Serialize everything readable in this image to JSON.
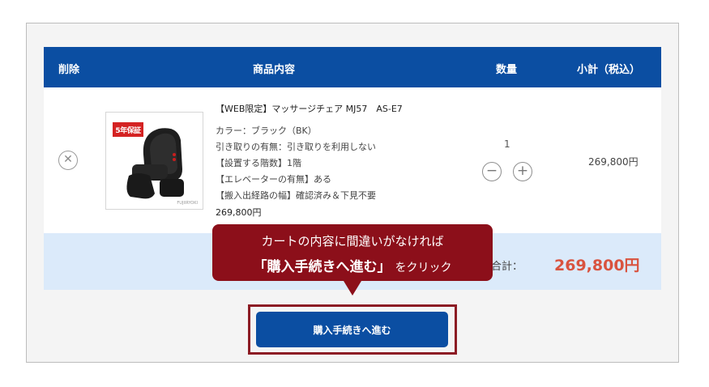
{
  "table": {
    "headers": {
      "delete": "削除",
      "product": "商品内容",
      "quantity": "数量",
      "subtotal": "小計（税込）"
    }
  },
  "item": {
    "remove_icon": "close-circle-icon",
    "image_alt": "マッサージチェア",
    "badge": "5年保証",
    "name": "【WEB限定】マッサージチェア MJ57　AS-E7",
    "options": [
      "カラー：ブラック（BK）",
      "引き取りの有無：引き取りを利用しない",
      "【設置する階数】1階",
      "【エレベーターの有無】ある",
      "【搬入出経路の幅】確認済み＆下見不要"
    ],
    "price": "269,800円",
    "quantity": "1",
    "minus_icon": "minus-circle-icon",
    "plus_icon": "plus-circle-icon",
    "line_subtotal": "269,800円"
  },
  "total": {
    "label": "合計：",
    "value": "269,800円"
  },
  "callout": {
    "line1": "カートの内容に間違いがなければ",
    "emphasis": "「購入手続きへ進む」",
    "line2_rest": "をクリック"
  },
  "checkout": {
    "label": "購入手続きへ進む"
  },
  "colors": {
    "header_blue": "#0b4ea2",
    "total_bar": "#dbeafa",
    "total_price": "#d9533f",
    "callout": "#8c0f1a"
  }
}
